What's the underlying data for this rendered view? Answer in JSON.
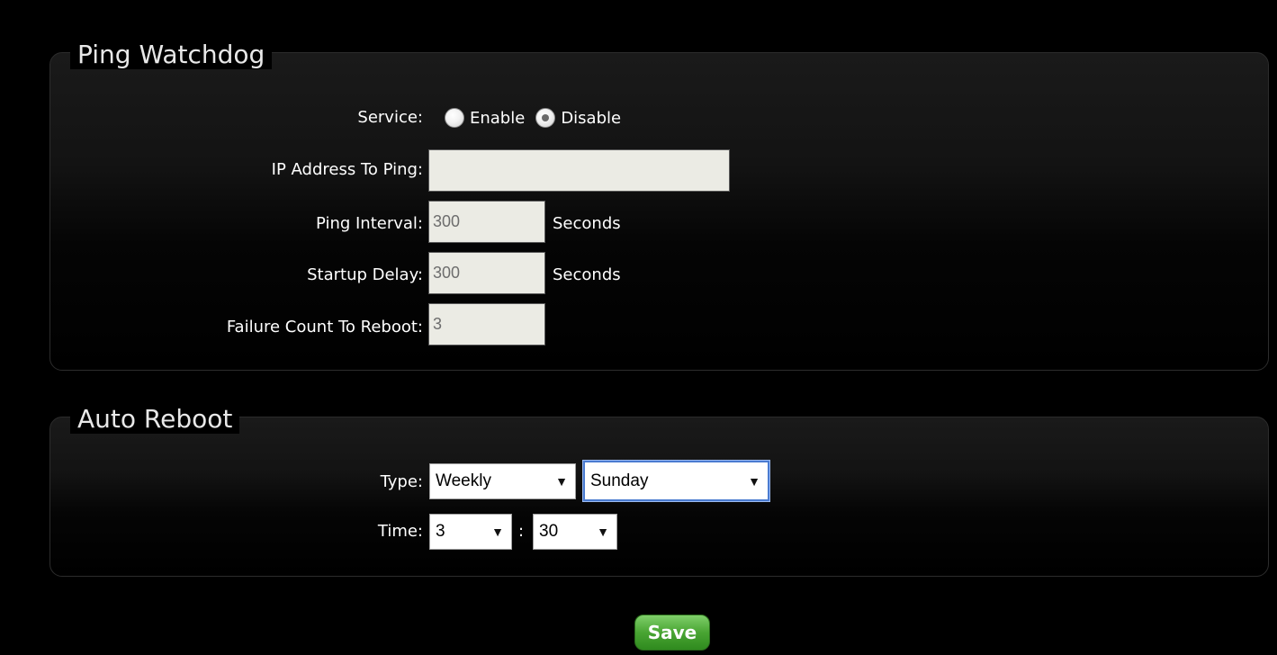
{
  "ping_watchdog": {
    "title": "Ping Watchdog",
    "service_label": "Service:",
    "service_options": [
      {
        "label": "Enable",
        "checked": false
      },
      {
        "label": "Disable",
        "checked": true
      }
    ],
    "ip_label": "IP Address To Ping:",
    "ip_value": "",
    "interval_label": "Ping Interval:",
    "interval_value": "300",
    "interval_unit": "Seconds",
    "delay_label": "Startup Delay:",
    "delay_value": "300",
    "delay_unit": "Seconds",
    "failure_label": "Failure Count To Reboot:",
    "failure_value": "3"
  },
  "auto_reboot": {
    "title": "Auto Reboot",
    "type_label": "Type:",
    "type_value": "Weekly",
    "day_value": "Sunday",
    "time_label": "Time:",
    "hour_value": "3",
    "time_separator": ":",
    "minute_value": "30"
  },
  "save_label": "Save",
  "colors": {
    "background": "#000000",
    "input_bg": "#ebebe4",
    "save_green": "#49a533",
    "focus_blue": "#4a7bd0"
  }
}
